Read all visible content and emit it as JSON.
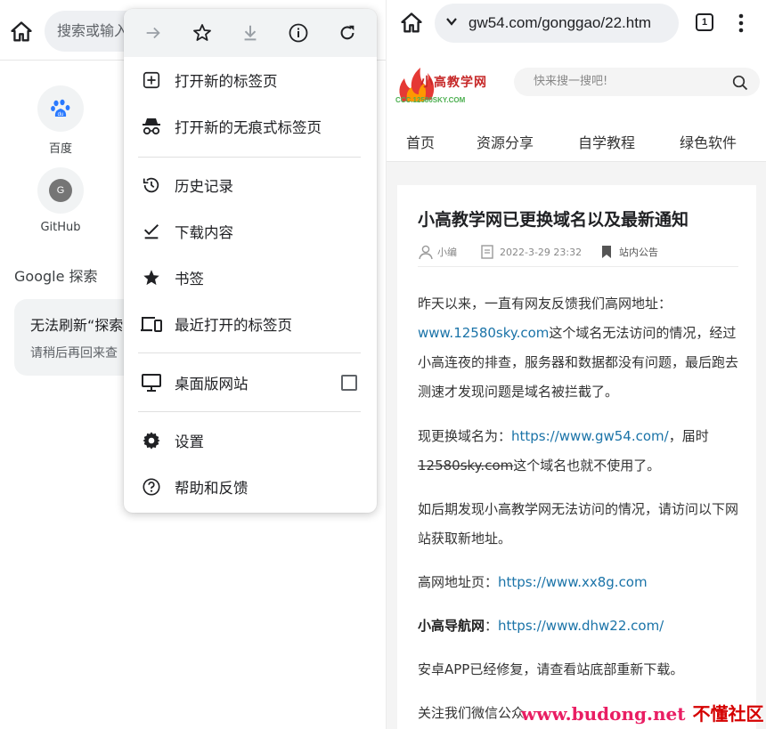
{
  "left": {
    "omnibox_placeholder": "搜索或输入",
    "shortcuts": [
      {
        "label": "百度",
        "icon": "baidu-paw-icon"
      },
      {
        "label": "GitHub",
        "icon": "github-letter-icon",
        "letter": "G"
      }
    ],
    "explore_title": "Google 探索",
    "explore_card": {
      "line1": "无法刷新“探索",
      "line2": "请稍后再回来查"
    }
  },
  "menu": {
    "top_icons": [
      "forward-arrow-icon",
      "bookmark-star-icon",
      "download-icon",
      "info-icon",
      "reload-icon"
    ],
    "items": [
      {
        "label": "打开新的标签页",
        "icon": "new-tab-icon"
      },
      {
        "label": "打开新的无痕式标签页",
        "icon": "incognito-icon"
      },
      {
        "label": "历史记录",
        "icon": "history-icon"
      },
      {
        "label": "下载内容",
        "icon": "downloads-check-icon"
      },
      {
        "label": "书签",
        "icon": "bookmarks-star-icon"
      },
      {
        "label": "最近打开的标签页",
        "icon": "recent-tabs-icon"
      },
      {
        "label": "桌面版网站",
        "icon": "desktop-icon",
        "checkbox": false
      },
      {
        "label": "设置",
        "icon": "settings-gear-icon"
      },
      {
        "label": "帮助和反馈",
        "icon": "help-icon"
      }
    ]
  },
  "right": {
    "url": "gw54.com/gonggao/22.htm",
    "tab_count": "1",
    "site": {
      "logo_text": "小高教学网",
      "logo_sub": "CCC.12580SKY.COM",
      "search_placeholder": "快来搜一搜吧!",
      "nav": [
        "首页",
        "资源分享",
        "自学教程",
        "绿色软件"
      ]
    },
    "article": {
      "title": "小高教学网已更换域名以及最新通知",
      "author": "小编",
      "date": "2022-3-29 23:32",
      "category": "站内公告",
      "p1": {
        "a": "昨天以来，一直有网友反馈我们高网地址：",
        "link": "www.12580sky.com",
        "b": "这个域名无法访问的情况，经过小高连夜的排查，服务器和数据都没有问题，最后跑去测速才发现问题是域名被拦截了。"
      },
      "p2": {
        "a": "现更换域名为：",
        "link": "https://www.gw54.com/",
        "b": "，届时",
        "del": "12580sky.com",
        "c": "这个域名也就不使用了。"
      },
      "p3": "如后期发现小高教学网无法访问的情况，请访问以下网站获取新地址。",
      "p4": {
        "a": "高网地址页：",
        "link": "https://www.xx8g.com"
      },
      "p5": {
        "bold": "小高导航网",
        "a": "：",
        "link": "https://www.dhw22.com/"
      },
      "p6": "安卓APP已经修复，请查看站底部重新下载。",
      "p7": "关注我们微信公众"
    }
  },
  "watermark": {
    "text1": "www.budong.net",
    "text2": "不懂社区"
  }
}
